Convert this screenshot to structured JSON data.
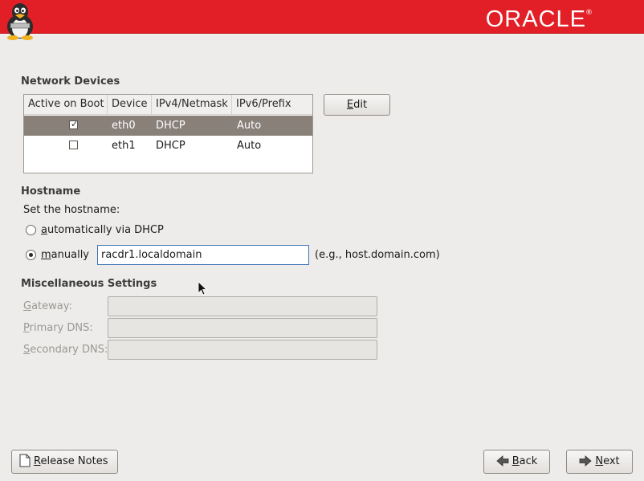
{
  "header": {
    "brand": "ORACLE",
    "brand_mark": "®",
    "mascot_icon": "tux-penguin-icon"
  },
  "network_devices": {
    "title": "Network Devices",
    "columns": [
      "Active on Boot",
      "Device",
      "IPv4/Netmask",
      "IPv6/Prefix"
    ],
    "rows": [
      {
        "active": true,
        "device": "eth0",
        "ipv4": "DHCP",
        "ipv6": "Auto",
        "selected": true
      },
      {
        "active": false,
        "device": "eth1",
        "ipv4": "DHCP",
        "ipv6": "Auto",
        "selected": false
      }
    ],
    "edit_button": {
      "prefix": "",
      "mnemonic": "E",
      "rest": "dit"
    }
  },
  "hostname": {
    "title": "Hostname",
    "prompt": "Set the hostname:",
    "option_dhcp": {
      "mnemonic": "a",
      "rest": "utomatically via DHCP",
      "selected": false
    },
    "option_manual": {
      "mnemonic": "m",
      "rest": "anually",
      "selected": true
    },
    "value": "racdr1.localdomain",
    "hint": "(e.g., host.domain.com)"
  },
  "misc": {
    "title": "Miscellaneous Settings",
    "gateway": {
      "mnemonic": "G",
      "rest": "ateway:",
      "value": ""
    },
    "primary_dns": {
      "mnemonic": "P",
      "rest": "rimary DNS:",
      "value": ""
    },
    "secondary_dns": {
      "mnemonic": "S",
      "rest": "econdary DNS:",
      "value": ""
    }
  },
  "footer": {
    "release_notes": {
      "mnemonic": "R",
      "rest": "elease Notes",
      "icon": "document-icon"
    },
    "back": {
      "mnemonic": "B",
      "rest": "ack",
      "icon": "arrow-left-icon"
    },
    "next": {
      "mnemonic": "N",
      "rest": "ext",
      "icon": "arrow-right-icon"
    }
  },
  "colors": {
    "header": "#e21f26",
    "selected_row": "#888079",
    "background": "#edeceb",
    "focus_border": "#3f74b6"
  }
}
